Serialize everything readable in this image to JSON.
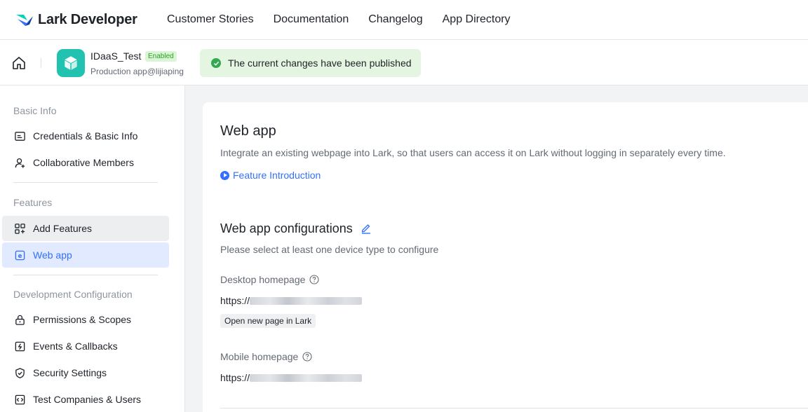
{
  "topnav": {
    "brand": "Lark Developer",
    "links": [
      "Customer Stories",
      "Documentation",
      "Changelog",
      "App Directory"
    ],
    "brand_color": "#3370ff"
  },
  "appbar": {
    "app_name": "IDaaS_Test",
    "status_badge": "Enabled",
    "app_subtitle": "Production app@lijiaping",
    "toast": "The current changes have been published"
  },
  "sidebar": {
    "sections": [
      {
        "title": "Basic Info",
        "items": [
          {
            "label": "Credentials & Basic Info",
            "icon": "id-card-icon"
          },
          {
            "label": "Collaborative Members",
            "icon": "user-add-icon"
          }
        ]
      },
      {
        "title": "Features",
        "items": [
          {
            "label": "Add Features",
            "icon": "add-grid-icon"
          },
          {
            "label": "Web app",
            "icon": "web-app-icon",
            "active": true
          }
        ]
      },
      {
        "title": "Development Configuration",
        "items": [
          {
            "label": "Permissions & Scopes",
            "icon": "lock-icon"
          },
          {
            "label": "Events & Callbacks",
            "icon": "event-icon"
          },
          {
            "label": "Security Settings",
            "icon": "shield-icon"
          },
          {
            "label": "Test Companies & Users",
            "icon": "code-icon"
          }
        ]
      }
    ]
  },
  "main": {
    "title": "Web app",
    "description": "Integrate an existing webpage into Lark, so that users can access it on Lark without logging in separately every time.",
    "feature_link": "Feature Introduction",
    "config_title": "Web app configurations",
    "config_hint": "Please select at least one device type to configure",
    "desktop_label": "Desktop homepage",
    "desktop_value": "https://",
    "desktop_tag": "Open new page in Lark",
    "mobile_label": "Mobile homepage",
    "mobile_value": "https://"
  }
}
